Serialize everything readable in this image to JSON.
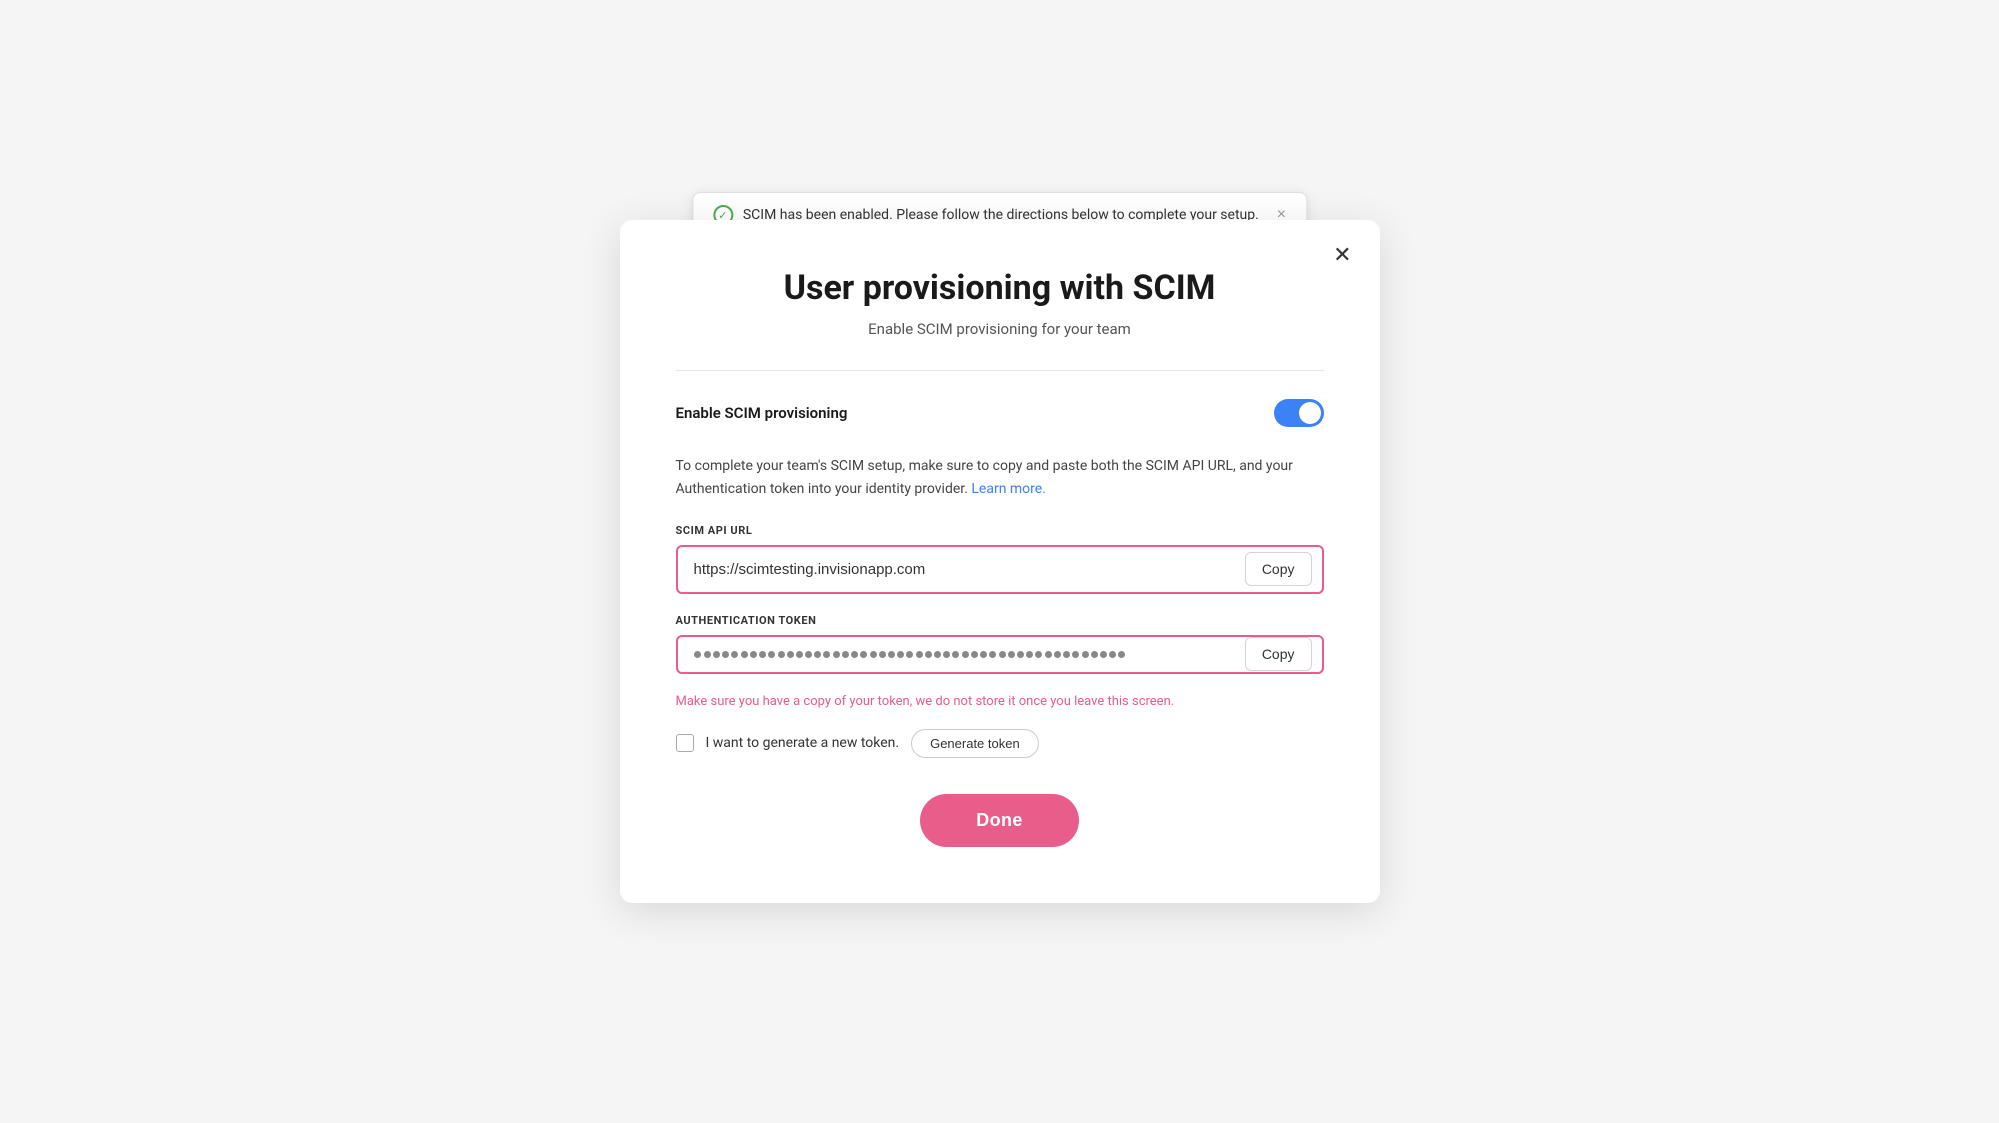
{
  "toast": {
    "message": "SCIM has been enabled. Please follow the directions below to complete your setup.",
    "icon": "✓",
    "close_label": "×"
  },
  "modal": {
    "title": "User provisioning with SCIM",
    "subtitle": "Enable SCIM provisioning for your team",
    "close_label": "✕",
    "toggle_label": "Enable SCIM provisioning",
    "toggle_checked": true,
    "description_part1": "To complete your team's SCIM setup, make sure to copy and paste both the SCIM API URL,\nand your Authentication token into your identity provider.",
    "learn_more_label": "Learn more.",
    "learn_more_href": "#",
    "scim_url_label": "SCIM API URL",
    "scim_url_value": "https://scimtesting.invisionapp.com",
    "scim_url_copy_label": "Copy",
    "auth_token_label": "Authentication token",
    "auth_token_copy_label": "Copy",
    "warning_text": "Make sure you have a copy of your token, we do not store it once you leave this screen.",
    "new_token_label": "I want to generate a new token.",
    "generate_token_label": "Generate token",
    "done_label": "Done"
  }
}
